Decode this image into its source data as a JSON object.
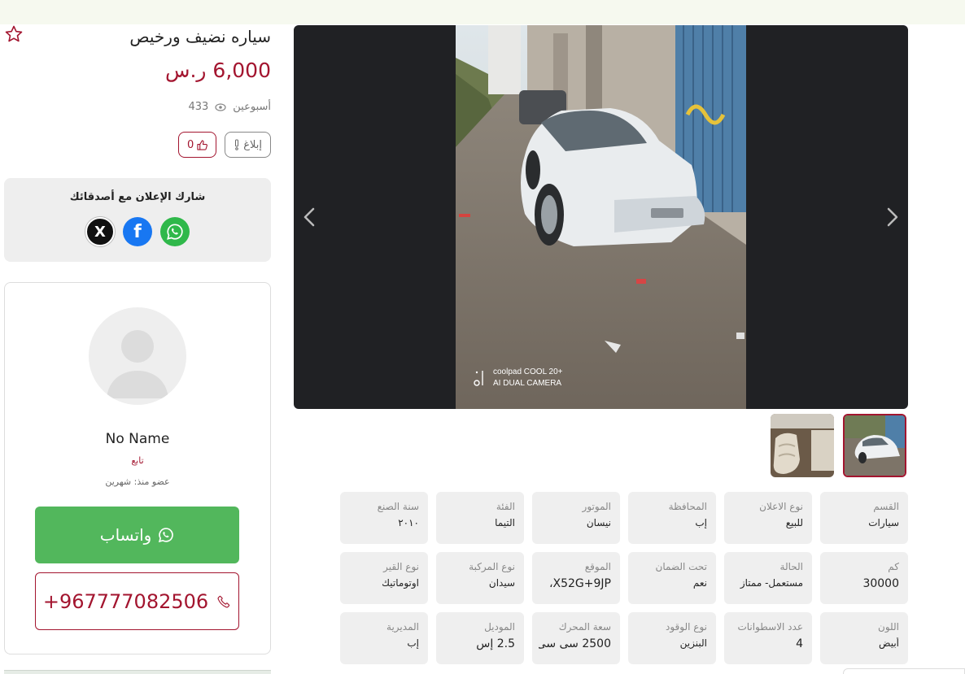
{
  "colors": {
    "accent": "#a3152f",
    "whatsapp": "#52b75c",
    "topbar": "#f6f9ef",
    "card_bg": "#efefef"
  },
  "listing": {
    "title": "سياره نضيف ورخيص",
    "price": "6,000 ر.س",
    "posted": "أسبوعين",
    "views": "433",
    "report_label": "إبلاغ",
    "likes": "0"
  },
  "share": {
    "title": "شارك الإعلان مع أصدقائك",
    "x_glyph": "X",
    "fb_glyph": "f"
  },
  "seller": {
    "name": "No Name",
    "follow_label": "تابع",
    "member_since": "عضو منذ: شهرين",
    "whatsapp_label": "واتساب",
    "phone": "+967777082506"
  },
  "gallery": {
    "watermark_line1": "coolpad COOL 20+",
    "watermark_line2": "AI DUAL CAMERA",
    "thumb_count": 2
  },
  "specs": [
    [
      {
        "label": "القسم",
        "value": "سيارات"
      },
      {
        "label": "نوع الاعلان",
        "value": "للبيع"
      },
      {
        "label": "المحافظة",
        "value": "إب"
      },
      {
        "label": "الموتور",
        "value": "نيسان"
      },
      {
        "label": "الفئة",
        "value": "التيما"
      },
      {
        "label": "سنة الصنع",
        "value": "٢٠١٠"
      }
    ],
    [
      {
        "label": "كم",
        "value": "30000"
      },
      {
        "label": "الحالة",
        "value": "مستعمل- ممتاز"
      },
      {
        "label": "تحت الضمان",
        "value": "نعم"
      },
      {
        "label": "الموقع",
        "value": "X52G+9JP،"
      },
      {
        "label": "نوع المركبة",
        "value": "سيدان"
      },
      {
        "label": "نوع القير",
        "value": "اوتوماتيك"
      }
    ],
    [
      {
        "label": "اللون",
        "value": "أبيض"
      },
      {
        "label": "عدد الاسطوانات",
        "value": "4"
      },
      {
        "label": "نوع الوقود",
        "value": "البنزين"
      },
      {
        "label": "سعة المحرك",
        "value": "2500 سى سى"
      },
      {
        "label": "الموديل",
        "value": "2.5 إس"
      },
      {
        "label": "المديرية",
        "value": "إب"
      }
    ]
  ]
}
